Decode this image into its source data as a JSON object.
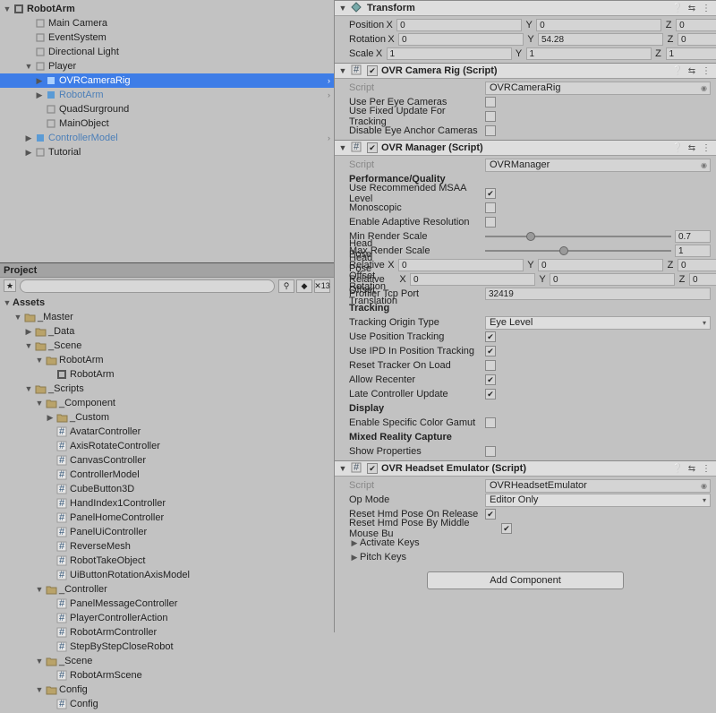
{
  "hierarchy": {
    "root": "RobotArm",
    "items": [
      {
        "label": "Main Camera",
        "indent": 2,
        "icon": "go"
      },
      {
        "label": "EventSystem",
        "indent": 2,
        "icon": "go"
      },
      {
        "label": "Directional Light",
        "indent": 2,
        "icon": "go"
      },
      {
        "label": "Player",
        "indent": 2,
        "icon": "go",
        "fold": "▼"
      },
      {
        "label": "OVRCameraRig",
        "indent": 3,
        "icon": "prefab",
        "fold": "▶",
        "selected": true,
        "arrowRight": true
      },
      {
        "label": "RobotArm",
        "indent": 3,
        "icon": "prefab",
        "fold": "▶",
        "blue": true,
        "arrowRight": true
      },
      {
        "label": "QuadSurground",
        "indent": 3,
        "icon": "go"
      },
      {
        "label": "MainObject",
        "indent": 3,
        "icon": "go"
      },
      {
        "label": "ControllerModel",
        "indent": 2,
        "icon": "prefab",
        "fold": "▶",
        "blue": true,
        "arrowRight": true
      },
      {
        "label": "Tutorial",
        "indent": 2,
        "icon": "go",
        "fold": "▶"
      }
    ]
  },
  "project": {
    "title": "Project",
    "search_placeholder": "",
    "hidden_count": "13",
    "items": [
      {
        "label": "Assets",
        "indent": 0,
        "fold": "▼",
        "bold": true,
        "icon": "none"
      },
      {
        "label": "_Master",
        "indent": 1,
        "fold": "▼",
        "icon": "folder"
      },
      {
        "label": "_Data",
        "indent": 2,
        "fold": "▶",
        "icon": "folder"
      },
      {
        "label": "_Scene",
        "indent": 2,
        "fold": "▼",
        "icon": "folder"
      },
      {
        "label": "RobotArm",
        "indent": 3,
        "fold": "▼",
        "icon": "folder"
      },
      {
        "label": "RobotArm",
        "indent": 4,
        "icon": "scene"
      },
      {
        "label": "_Scripts",
        "indent": 2,
        "fold": "▼",
        "icon": "folder"
      },
      {
        "label": "_Component",
        "indent": 3,
        "fold": "▼",
        "icon": "folder"
      },
      {
        "label": "_Custom",
        "indent": 4,
        "fold": "▶",
        "icon": "folder"
      },
      {
        "label": "AvatarController",
        "indent": 4,
        "icon": "cs"
      },
      {
        "label": "AxisRotateController",
        "indent": 4,
        "icon": "cs"
      },
      {
        "label": "CanvasController",
        "indent": 4,
        "icon": "cs"
      },
      {
        "label": "ControllerModel",
        "indent": 4,
        "icon": "cs"
      },
      {
        "label": "CubeButton3D",
        "indent": 4,
        "icon": "cs"
      },
      {
        "label": "HandIndex1Controller",
        "indent": 4,
        "icon": "cs"
      },
      {
        "label": "PanelHomeController",
        "indent": 4,
        "icon": "cs"
      },
      {
        "label": "PanelUiController",
        "indent": 4,
        "icon": "cs"
      },
      {
        "label": "ReverseMesh",
        "indent": 4,
        "icon": "cs"
      },
      {
        "label": "RobotTakeObject",
        "indent": 4,
        "icon": "cs"
      },
      {
        "label": "UiButtonRotationAxisModel",
        "indent": 4,
        "icon": "cs"
      },
      {
        "label": "_Controller",
        "indent": 3,
        "fold": "▼",
        "icon": "folder"
      },
      {
        "label": "PanelMessageController",
        "indent": 4,
        "icon": "cs"
      },
      {
        "label": "PlayerControllerAction",
        "indent": 4,
        "icon": "cs"
      },
      {
        "label": "RobotArmController",
        "indent": 4,
        "icon": "cs"
      },
      {
        "label": "StepByStepCloseRobot",
        "indent": 4,
        "icon": "cs"
      },
      {
        "label": "_Scene",
        "indent": 3,
        "fold": "▼",
        "icon": "folder"
      },
      {
        "label": "RobotArmScene",
        "indent": 4,
        "icon": "cs"
      },
      {
        "label": "Config",
        "indent": 3,
        "fold": "▼",
        "icon": "folder"
      },
      {
        "label": "Config",
        "indent": 4,
        "icon": "cs"
      }
    ]
  },
  "inspector": {
    "transform": {
      "title": "Transform",
      "position": {
        "label": "Position",
        "x": "0",
        "y": "0",
        "z": "0"
      },
      "rotation": {
        "label": "Rotation",
        "x": "0",
        "y": "54.28",
        "z": "0"
      },
      "scale": {
        "label": "Scale",
        "x": "1",
        "y": "1",
        "z": "1"
      }
    },
    "camRig": {
      "title": "OVR Camera Rig (Script)",
      "script_label": "Script",
      "script_val": "OVRCameraRig",
      "p1": "Use Per Eye Cameras",
      "p2": "Use Fixed Update For Tracking",
      "p3": "Disable Eye Anchor Cameras"
    },
    "manager": {
      "title": "OVR Manager (Script)",
      "script_label": "Script",
      "script_val": "OVRManager",
      "sec1": "Performance/Quality",
      "pMsaa": "Use Recommended MSAA Level",
      "pMono": "Monoscopic",
      "pAdapt": "Enable Adaptive Resolution",
      "pMin": "Min Render Scale",
      "minVal": "0.7",
      "pMax": "Max Render Scale",
      "maxVal": "1",
      "pRotOff": "Head Pose Relative Offset Rotation",
      "rot": {
        "x": "0",
        "y": "0",
        "z": "0"
      },
      "pTrOff": "Head Pose Relative Offset Translation",
      "tr": {
        "x": "0",
        "y": "0",
        "z": "0"
      },
      "pPort": "Profiler Tcp Port",
      "portVal": "32419",
      "sec2": "Tracking",
      "pOrigin": "Tracking Origin Type",
      "originVal": "Eye Level",
      "pPosTrk": "Use Position Tracking",
      "pIpd": "Use IPD In Position Tracking",
      "pReset": "Reset Tracker On Load",
      "pRecenter": "Allow Recenter",
      "pLate": "Late Controller Update",
      "sec3": "Display",
      "pGamut": "Enable Specific Color Gamut",
      "sec4": "Mixed Reality Capture",
      "pShow": "Show Properties"
    },
    "headset": {
      "title": "OVR Headset Emulator (Script)",
      "script_label": "Script",
      "script_val": "OVRHeadsetEmulator",
      "pOp": "Op Mode",
      "opVal": "Editor Only",
      "pRel": "Reset Hmd Pose On Release",
      "pMid": "Reset Hmd Pose By Middle Mouse Bu",
      "pAct": "Activate Keys",
      "pPitch": "Pitch Keys"
    },
    "addComp": "Add Component"
  },
  "axes": {
    "x": "X",
    "y": "Y",
    "z": "Z"
  }
}
